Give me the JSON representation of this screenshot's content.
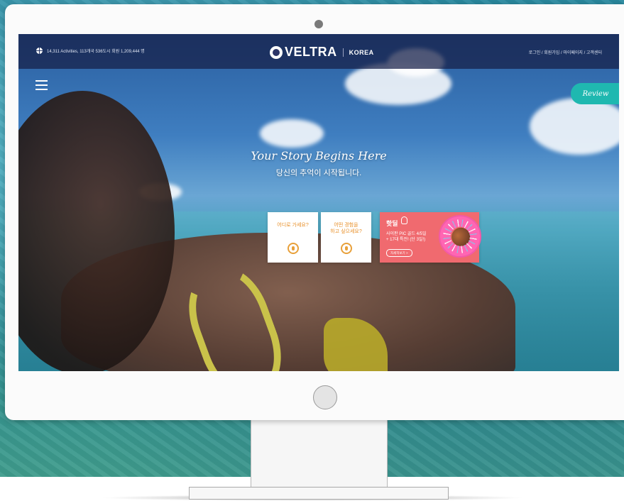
{
  "colors": {
    "accent_teal": "#1fb8b0",
    "hotdeal_pink": "#f06a6f",
    "card_orange": "#e8902a",
    "header_bg": "#161e46"
  },
  "header": {
    "stats_text": "14,311 Activities, 113개국 536도시 회원 1,209,444 명",
    "brand_name": "VELTRA",
    "brand_country": "KOREA",
    "account_links": "로그인 / 회원가입 / 마이페이지 / 고객센터"
  },
  "menu": {
    "icon": "hamburger-icon"
  },
  "review_tab": {
    "label": "Review"
  },
  "hero": {
    "title": "Your Story Begins Here",
    "subtitle": "당신의 추억이 시작됩니다."
  },
  "cards": [
    {
      "label": "어디로 가세요?",
      "icon": "map-pin-icon"
    },
    {
      "label": "어떤 경험을\n하고 싶으세요?",
      "icon": "heart-icon"
    }
  ],
  "hotdeal": {
    "title": "핫딜",
    "icon": "hand-pointer-icon",
    "description": "사이판 PIC 골드 4/5일\n+ 17대 특전! (단 3일!)",
    "button_label": "자세히보기 >"
  }
}
